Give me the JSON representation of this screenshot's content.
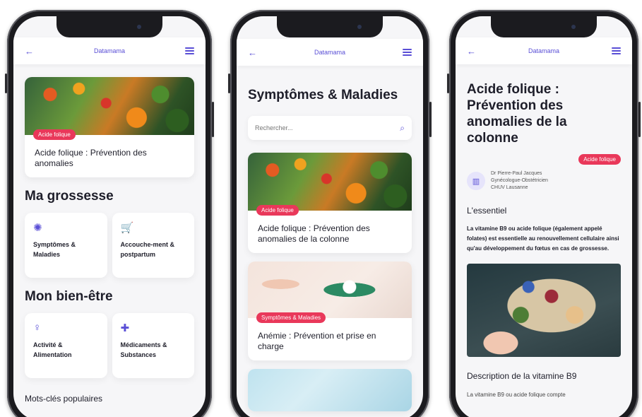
{
  "app": {
    "title": "Datamama"
  },
  "phone1": {
    "featured": {
      "tag": "Acide folique",
      "title": "Acide folique : Prévention des anomalies"
    },
    "grossesse": {
      "title": "Ma grossesse",
      "tiles": [
        {
          "icon": "virus-icon",
          "glyph": "✺",
          "label": "Symptômes & Maladies"
        },
        {
          "icon": "stroller-icon",
          "glyph": "🛒",
          "label": "Accouche-ment & postpartum"
        }
      ]
    },
    "bienetre": {
      "title": "Mon bien-être",
      "tiles": [
        {
          "icon": "pregnant-woman-icon",
          "glyph": "♀",
          "label": "Activité & Alimentation"
        },
        {
          "icon": "medication-icon",
          "glyph": "✚",
          "label": "Médicaments & Substances"
        }
      ]
    },
    "keywords_title": "Mots-clés populaires"
  },
  "phone2": {
    "title": "Symptômes & Maladies",
    "search_placeholder": "Rechercher...",
    "cards": [
      {
        "tag": "Acide folique",
        "title": "Acide folique : Prévention des anomalies de la colonne"
      },
      {
        "tag": "Symptômes & Maladies",
        "title": "Anémie : Prévention et prise en charge"
      }
    ]
  },
  "phone3": {
    "title": "Acide folique : Prévention des anomalies de la colonne",
    "tag": "Acide folique",
    "author": {
      "name": "Dr Pierre-Paul Jacques",
      "role": "Gynécologue-Obstétricien",
      "org": "CHUV Lausanne"
    },
    "essentiel_title": "L'essentiel",
    "essentiel_text": "La vitamine B9 ou acide folique (également appelé folates) est essentielle au renouvellement cellulaire ainsi qu'au développement du fœtus en cas de grossesse.",
    "description_title": "Description de la vitamine B9",
    "description_text": "La vitamine B9 ou acide folique compte"
  }
}
